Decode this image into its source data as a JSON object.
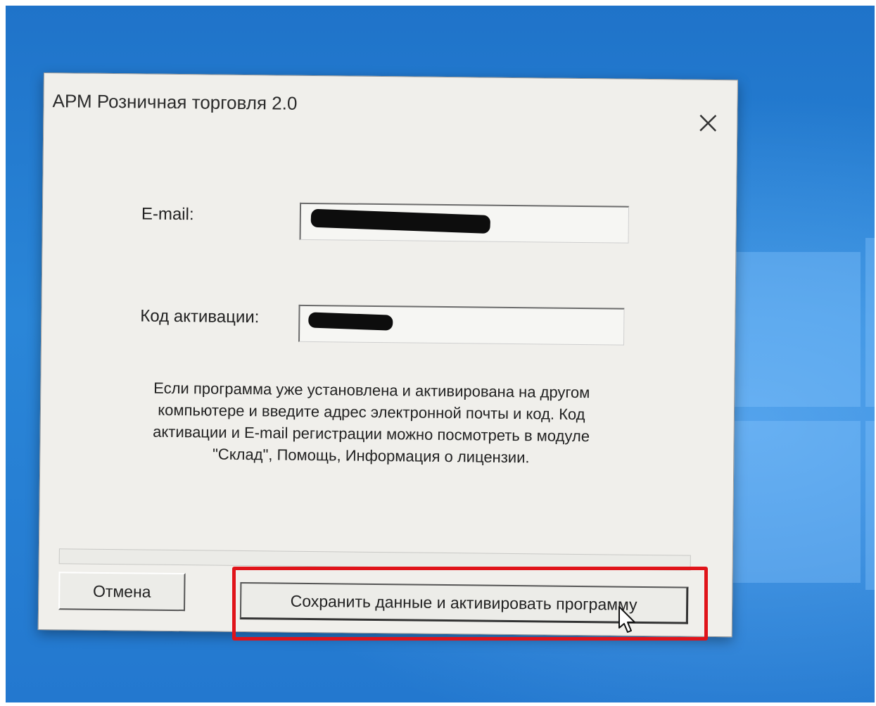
{
  "dialog": {
    "title": "АРМ Розничная торговля 2.0",
    "email_label": "E-mail:",
    "email_value": "",
    "code_label": "Код активации:",
    "code_value": "",
    "info_text": "Если программа уже установлена и активирована на другом компьютере и введите адрес электронной почты и код. Код активации и E-mail регистрации можно посмотреть в модуле \"Склад\", Помощь, Информация о лицензии.",
    "cancel_label": "Отмена",
    "activate_label": "Сохранить данные и активировать программу"
  },
  "colors": {
    "desktop_blue": "#2a86d8",
    "dialog_bg": "#f0efeb",
    "highlight_red": "#e0141a"
  },
  "icons": {
    "close": "close-icon",
    "cursor": "mouse-pointer-icon"
  }
}
